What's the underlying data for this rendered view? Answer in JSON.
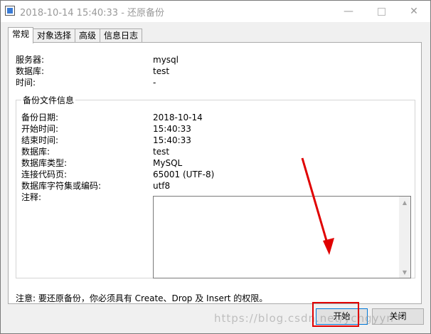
{
  "window": {
    "title": "2018-10-14 15:40:33 - 还原备份",
    "minimize_glyph": "—",
    "close_glyph": "✕"
  },
  "tabs": [
    {
      "label": "常规",
      "active": true
    },
    {
      "label": "对象选择",
      "active": false
    },
    {
      "label": "高级",
      "active": false
    },
    {
      "label": "信息日志",
      "active": false
    }
  ],
  "general": {
    "server_label": "服务器:",
    "server_value": "mysql",
    "database_label": "数据库:",
    "database_value": "test",
    "time_label": "时间:",
    "time_value": "-"
  },
  "backup_info": {
    "group_title": "备份文件信息",
    "backup_date_label": "备份日期:",
    "backup_date_value": "2018-10-14",
    "start_time_label": "开始时间:",
    "start_time_value": "15:40:33",
    "end_time_label": "结束时间:",
    "end_time_value": "15:40:33",
    "database_label": "数据库:",
    "database_value": "test",
    "db_type_label": "数据库类型:",
    "db_type_value": "MySQL",
    "codepage_label": "连接代码页:",
    "codepage_value": "65001 (UTF-8)",
    "charset_label": "数据库字符集或编码:",
    "charset_value": "utf8",
    "notes_label": "注释:",
    "notes_value": ""
  },
  "notice": "注意: 要还原备份，你必须具有 Create、Drop 及 Insert 的权限。",
  "buttons": {
    "start_label": "开始",
    "close_label": "关闭"
  },
  "watermark": "https://blog.csdn.net/ychgyyn",
  "colors": {
    "annotation": "#e00000",
    "focus_border": "#0078d7"
  }
}
